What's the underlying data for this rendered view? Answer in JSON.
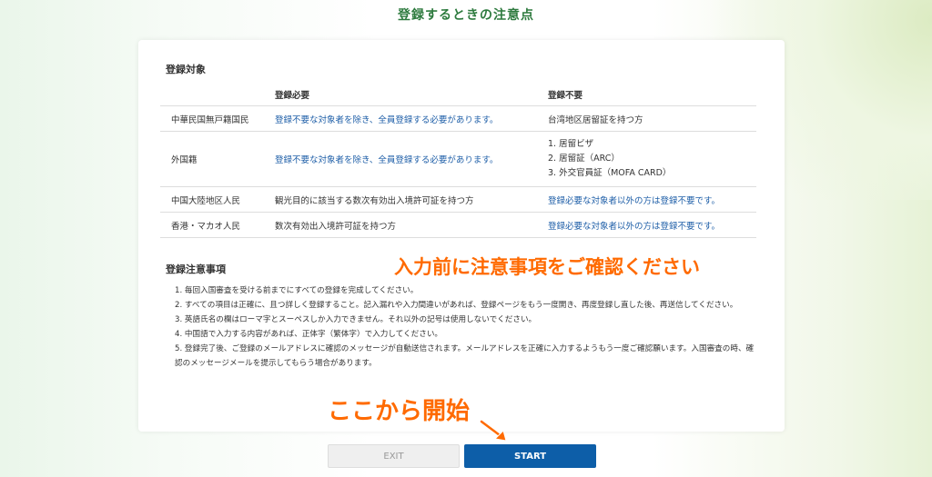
{
  "page_title": "登録するときの注意点",
  "section1_title": "登録対象",
  "table": {
    "headers": [
      "",
      "登録必要",
      "登録不要"
    ],
    "rows": [
      {
        "category": "中華民国無戸籍国民",
        "required": "登録不要な対象者を除き、全員登録する必要があります。",
        "not_required": "台湾地区居留証を持つ方"
      },
      {
        "category": "外国籍",
        "required": "登録不要な対象者を除き、全員登録する必要があります。",
        "not_required_list": [
          "1. 居留ビザ",
          "2. 居留証（ARC）",
          "3. 外交官員証（MOFA CARD）"
        ]
      },
      {
        "category": "中国大陸地区人民",
        "required": "観光目的に該当する数次有効出入境許可証を持つ方",
        "not_required": "登録必要な対象者以外の方は登録不要です。"
      },
      {
        "category": "香港・マカオ人民",
        "required": "数次有効出入境許可証を持つ方",
        "not_required": "登録必要な対象者以外の方は登録不要です。"
      }
    ]
  },
  "section2_title": "登録注意事項",
  "notes": [
    "1. 毎回入国審査を受ける前までにすべての登録を完成してください。",
    "2. すべての項目は正確に、且つ詳しく登録すること。記入漏れや入力間違いがあれば、登録ページをもう一度開き、再度登録し直した後、再送信してください。",
    "3. 英語氏名の欄はローマ字とスーペスしか入力できません。それ以外の記号は使用しないでください。",
    "4. 中国語で入力する内容があれば、正体字（繁体字）で入力してください。",
    "5. 登録完了後、ご登録のメールアドレスに確認のメッセージが自動送信されます。メールアドレスを正確に入力するようもう一度ご確認願います。入国審査の時、確認のメッセージメールを提示してもらう場合があります。"
  ],
  "annotations": {
    "confirm": "入力前に注意事項をご確認ください",
    "start_here": "ここから開始"
  },
  "buttons": {
    "exit": "EXIT",
    "start": "START"
  },
  "colors": {
    "title_green": "#2d7a3e",
    "link_blue": "#1f5fa8",
    "annotation_orange": "#ff6a00",
    "start_blue": "#0d5ea8"
  }
}
